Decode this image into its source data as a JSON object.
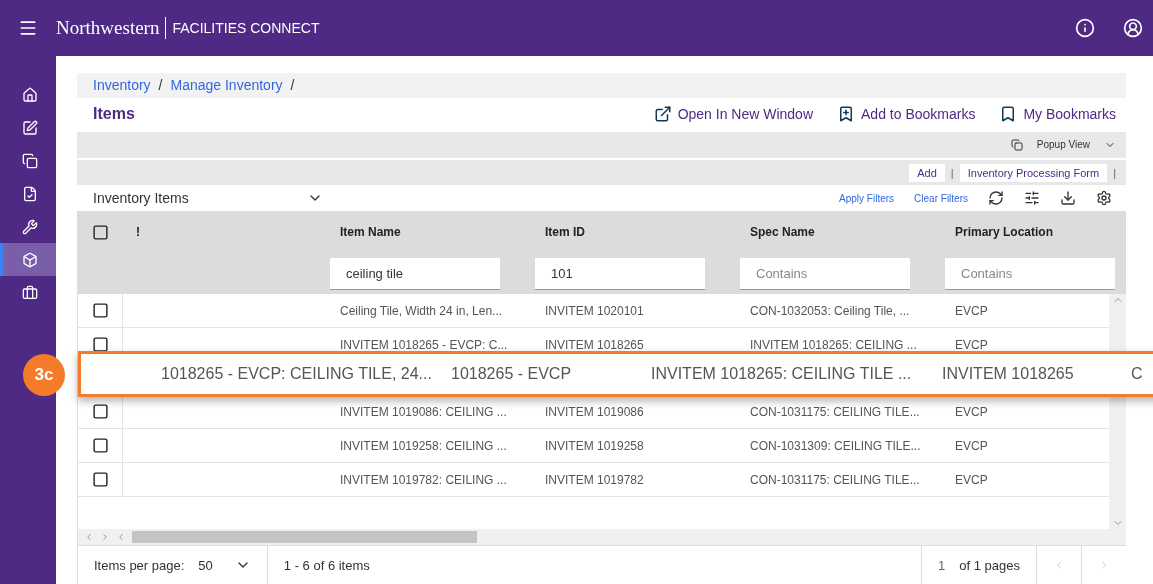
{
  "header": {
    "brand": "Northwestern",
    "product": "FACILITIES CONNECT"
  },
  "sidebar": {
    "items": [
      {
        "selected": false
      },
      {
        "selected": false
      },
      {
        "selected": false
      },
      {
        "selected": false
      },
      {
        "selected": false
      },
      {
        "selected": true
      },
      {
        "selected": false
      }
    ]
  },
  "breadcrumb": [
    {
      "label": "Inventory",
      "separator": "/"
    },
    {
      "label": "Manage Inventory",
      "separator": "/"
    }
  ],
  "page_title": "Items",
  "page_actions": [
    {
      "kind": "window",
      "label": "Open In New Window"
    },
    {
      "kind": "add-bookmark",
      "label": "Add to Bookmarks"
    },
    {
      "kind": "bookmarks",
      "label": "My Bookmarks"
    }
  ],
  "popup_view": "Popup View",
  "toolbar_buttons": [
    {
      "label": "Add",
      "separator": "|"
    },
    {
      "label": "Inventory Processing Form",
      "separator": "|"
    }
  ],
  "view_select": "Inventory Items",
  "filter_links": [
    "Apply Filters",
    "Clear Filters"
  ],
  "table": {
    "columns": [
      {
        "label": "!"
      },
      {
        "label": "Item Name",
        "filter": {
          "value": "ceiling tile"
        }
      },
      {
        "label": "Item ID",
        "filter": {
          "value": "101"
        }
      },
      {
        "label": "Spec Name",
        "filter": {
          "placeholder": "Contains"
        }
      },
      {
        "label": "Primary Location",
        "filter": {
          "placeholder": "Contains"
        }
      }
    ],
    "header_checked": false,
    "rows": [
      {
        "checked": false,
        "cells": [
          "",
          "Ceiling Tile, Width 24 in, Len...",
          "INVITEM 1020101",
          "CON-1032053: Ceiling Tile, ...",
          "EVCP"
        ]
      },
      {
        "checked": false,
        "cells": [
          "",
          "INVITEM 1018265 - EVCP: C...",
          "INVITEM 1018265",
          "INVITEM 1018265: CEILING ...",
          "EVCP"
        ]
      },
      {
        "checked": false,
        "cells": [
          "",
          "INVITEM 1019086: CEILING ...",
          "INVITEM 1019086",
          "CON-1031175: CEILING TILE...",
          "EVCP"
        ]
      },
      {
        "checked": false,
        "cells": [
          "",
          "INVITEM 1019258: CEILING ...",
          "INVITEM 1019258",
          "CON-1031309: CEILING TILE...",
          "EVCP"
        ]
      },
      {
        "checked": false,
        "cells": [
          "",
          "INVITEM 1019782: CEILING ...",
          "INVITEM 1019782",
          "CON-1031175: CEILING TILE...",
          "EVCP"
        ]
      }
    ]
  },
  "highlight": {
    "badge": "3c",
    "cells": [
      "1018265 - EVCP: CEILING TILE, 24...",
      "1018265 - EVCP",
      "INVITEM 1018265: CEILING TILE ...",
      "INVITEM 1018265",
      "C"
    ]
  },
  "pagination": {
    "per_page_label": "Items per page:",
    "per_page": "50",
    "range": "1 - 6 of 6 items",
    "page": "1",
    "pages": "of 1 pages"
  }
}
